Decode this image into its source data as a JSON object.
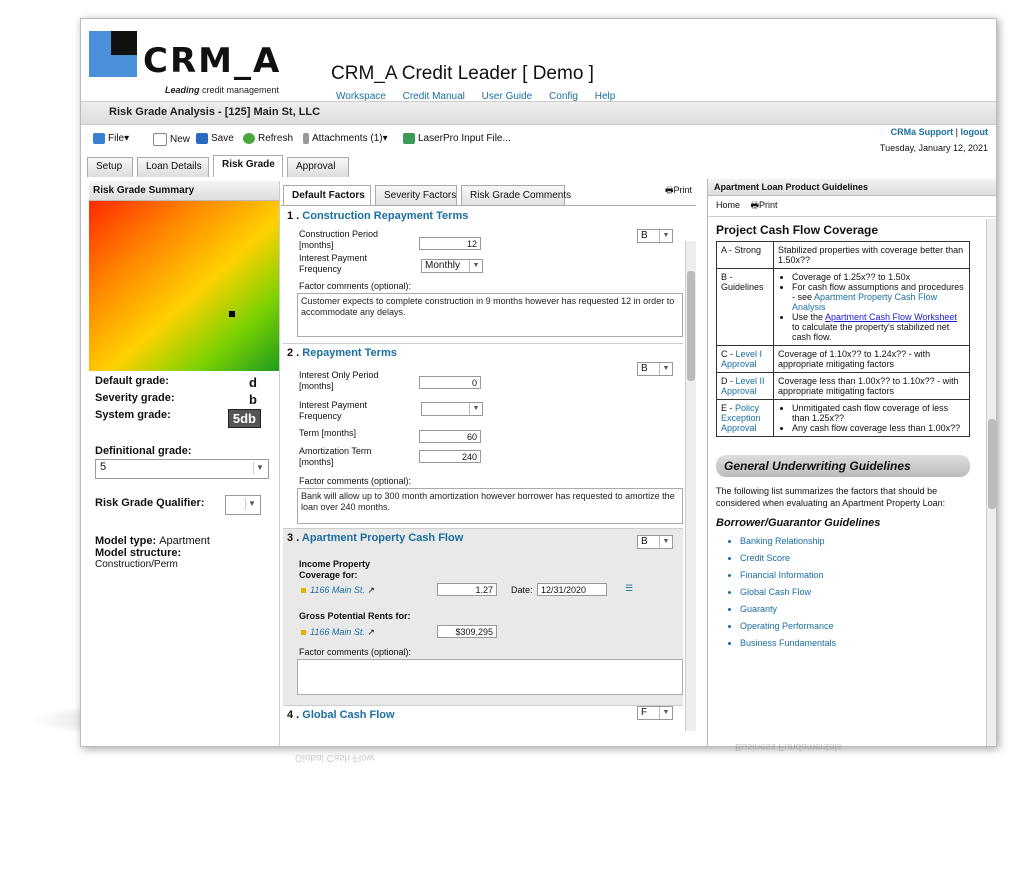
{
  "brand": {
    "logo_text": "CRM_A",
    "tag_em": "Leading",
    "tag_rest": " credit management"
  },
  "app": {
    "title": "CRM_A Credit Leader [ Demo ]"
  },
  "topnav": [
    "Workspace",
    "Credit Manual",
    "User Guide",
    "Config",
    "Help"
  ],
  "support": {
    "user": "CRMa Support",
    "logout": "logout",
    "date": "Tuesday, January 12, 2021"
  },
  "page": {
    "title": "Risk Grade Analysis - [125] Main St, LLC"
  },
  "toolbar": {
    "file": "File",
    "new": "New",
    "save": "Save",
    "refresh": "Refresh",
    "attachments": "Attachments (1)",
    "laserpro": "LaserPro Input File..."
  },
  "tabs": [
    "Setup",
    "Loan Details",
    "Risk Grade",
    "Approval"
  ],
  "print_label": "Print",
  "left": {
    "header": "Risk Grade Summary",
    "default_label": "Default grade:",
    "default_value": "d",
    "severity_label": "Severity grade:",
    "severity_value": "b",
    "system_label": "System grade:",
    "system_value": "5db",
    "definitional_label": "Definitional grade:",
    "definitional_value": "5",
    "qualifier_label": "Risk Grade Qualifier:",
    "model_type_label": "Model type:",
    "model_type_value": "Apartment",
    "model_structure_label": "Model structure:",
    "model_structure_value": "Construction/Perm"
  },
  "subtabs": [
    "Default Factors",
    "Severity Factors",
    "Risk Grade Comments"
  ],
  "factors": {
    "f1": {
      "num": "1 .",
      "title": "Construction Repayment Terms",
      "grade": "B",
      "period_label1": "Construction Period",
      "period_label2": "[months]",
      "period_value": "12",
      "freq_label1": "Interest Payment",
      "freq_label2": "Frequency",
      "freq_value": "Monthly",
      "comments_label": "Factor comments (optional):",
      "comment": "Customer expects to complete construction in 9 months however has requested 12 in order to accommodate any delays."
    },
    "f2": {
      "num": "2 .",
      "title": "Repayment Terms",
      "grade": "B",
      "io_label1": "Interest Only Period",
      "io_label2": "[months]",
      "io_value": "0",
      "freq_label1": "Interest Payment",
      "freq_label2": "Frequency",
      "term_label": "Term [months]",
      "term_value": "60",
      "amort_label1": "Amortization Term",
      "amort_label2": "[months]",
      "amort_value": "240",
      "comments_label": "Factor comments (optional):",
      "comment": "Bank will allow up to 300 month amortization however borrower has requested to amortize the loan over 240 months."
    },
    "f3": {
      "num": "3 .",
      "title": "Apartment Property Cash Flow",
      "grade": "B",
      "income_label1": "Income Property",
      "income_label2": "Coverage for:",
      "prop1": "1166 Main St.",
      "coverage_value": "1.27",
      "date_label": "Date:",
      "date_value": "12/31/2020",
      "rents_label": "Gross Potential Rents for:",
      "prop2": "1166 Main St.",
      "rents_value": "$309,295",
      "comments_label": "Factor comments (optional):"
    },
    "f4": {
      "num": "4 .",
      "title": "Global Cash Flow",
      "grade": "F"
    }
  },
  "right": {
    "header": "Apartment Loan Product Guidelines",
    "nav_home": "Home",
    "nav_print": "Print",
    "title": "Project Cash Flow Coverage",
    "rows": {
      "a_key": "A - Strong",
      "a_text": "Stabilized properties with coverage better than 1.50x??",
      "b_key1": "B -",
      "b_key2": "Guidelines",
      "b_li1": "Coverage of 1.25x?? to 1.50x",
      "b_li2_pre": "For cash flow assumptions and procedures - see ",
      "b_li2_link": "Apartment Property Cash Flow Analysis",
      "b_li3_pre": "Use the ",
      "b_li3_link": "Apartment Cash Flow Worksheet",
      "b_li3_post": " to calculate the property's stabilized net cash flow.",
      "c_key1": "C - ",
      "c_key2": "Level I Approval",
      "c_text": "Coverage of 1.10x?? to 1.24x?? - with appropriate mitigating factors",
      "d_key1": "D - ",
      "d_key2": "Level II Approval",
      "d_text": "Coverage less than 1.00x?? to 1.10x?? - with appropriate mitigating factors",
      "e_key1": "E - ",
      "e_key2": "Policy Exception Approval",
      "e_li1": "Unmitigated cash flow coverage of less than 1.25x??",
      "e_li2": "Any cash flow coverage less than 1.00x??"
    },
    "section_title": "General Underwriting Guidelines",
    "section_text": "The following list summarizes the factors that should be considered when evaluating an Apartment Property Loan:",
    "sub_title": "Borrower/Guarantor Guidelines",
    "links": [
      "Banking Relationship",
      "Credit Score",
      "Financial Information",
      "Global Cash Flow",
      "Guaranty",
      "Operating Performance",
      "Business Fundamentals"
    ]
  },
  "colors": {
    "accent": "#1a6fa0",
    "logo_blue": "#4a90d9"
  }
}
